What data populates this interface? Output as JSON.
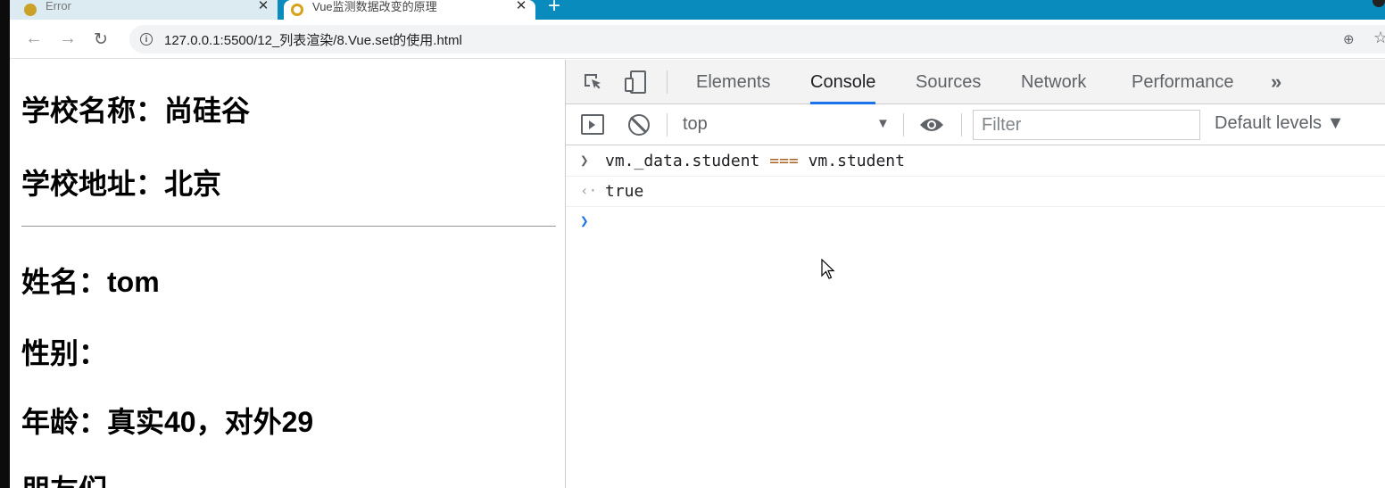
{
  "browser": {
    "tabs": [
      {
        "title": "Error",
        "active": false
      },
      {
        "title": "Vue监测数据改变的原理",
        "active": true
      }
    ],
    "tab_close_glyph": "✕",
    "new_tab_glyph": "+",
    "url": "127.0.0.1:5500/12_列表渲染/8.Vue.set的使用.html"
  },
  "page": {
    "school_name": "学校名称：尚硅谷",
    "school_address": "学校地址：北京",
    "student_name": "姓名：tom",
    "student_sex": "性别：",
    "student_age": "年龄：真实40，对外29",
    "friends_heading": "朋友们"
  },
  "devtools": {
    "tabs": [
      "Elements",
      "Console",
      "Sources",
      "Network",
      "Performance"
    ],
    "active_tab": "Console",
    "more_tabs_glyph": "»",
    "context": "top",
    "filter_placeholder": "Filter",
    "levels_label": "Default levels ▼",
    "accent_color": "#1a73e8",
    "console_lines": [
      {
        "kind": "input",
        "left": "vm._data.student",
        "operator": "===",
        "right": "vm.student"
      },
      {
        "kind": "output",
        "value": "true"
      }
    ]
  }
}
